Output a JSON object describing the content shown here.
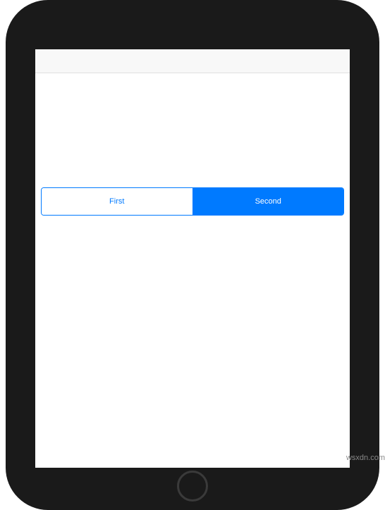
{
  "segmented_control": {
    "segments": [
      {
        "label": "First",
        "selected": false
      },
      {
        "label": "Second",
        "selected": true
      }
    ]
  },
  "watermark": "wsxdn.com"
}
